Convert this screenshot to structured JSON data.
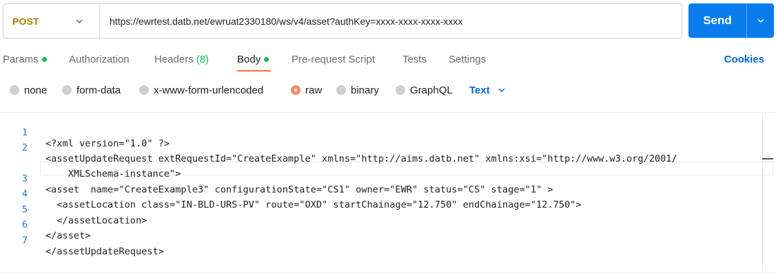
{
  "request": {
    "method": "POST",
    "url": "https://ewrtest.datb.net/ewruat2330180/ws/v4/asset?authKey=xxxx-xxxx-xxxx-xxxx",
    "send_label": "Send"
  },
  "tabs": {
    "params": "Params",
    "authorization": "Authorization",
    "headers": "Headers",
    "headers_count": "(8)",
    "body": "Body",
    "prerequest": "Pre-request Script",
    "tests": "Tests",
    "settings": "Settings",
    "cookies": "Cookies",
    "active": "Body"
  },
  "body_types": {
    "none": "none",
    "form_data": "form-data",
    "urlencoded": "x-www-form-urlencoded",
    "raw": "raw",
    "binary": "binary",
    "graphql": "GraphQL",
    "selected": "raw",
    "format": "Text"
  },
  "editor": {
    "lines": [
      {
        "n": "1",
        "text": "<?xml version=\"1.0\" ?>"
      },
      {
        "n": "2",
        "text": "<assetUpdateRequest extRequestId=\"CreateExample\" xmlns=\"http://aims.datb.net\" xmlns:xsi=\"http://www.w3.org/2001/"
      },
      {
        "n": "",
        "text": "    XMLSchema-instance\">"
      },
      {
        "n": "3",
        "text": "<asset  name=\"CreateExample3\" configurationState=\"CS1\" owner=\"EWR\" status=\"CS\" stage=\"1\" >"
      },
      {
        "n": "4",
        "text": "  <assetLocation class=\"IN-BLD-URS-PV\" route=\"OXD\" startChainage=\"12.750\" endChainage=\"12.750\">"
      },
      {
        "n": "5",
        "text": "  </assetLocation>"
      },
      {
        "n": "6",
        "text": "</asset>"
      },
      {
        "n": "7",
        "text": "</assetUpdateRequest>"
      }
    ]
  },
  "colors": {
    "method": "#ad7a03",
    "send": "#097bed",
    "accent": "#ff6c37",
    "status_dot": "#0cbb52",
    "link": "#0265d2",
    "line_number": "#2b7da8"
  }
}
